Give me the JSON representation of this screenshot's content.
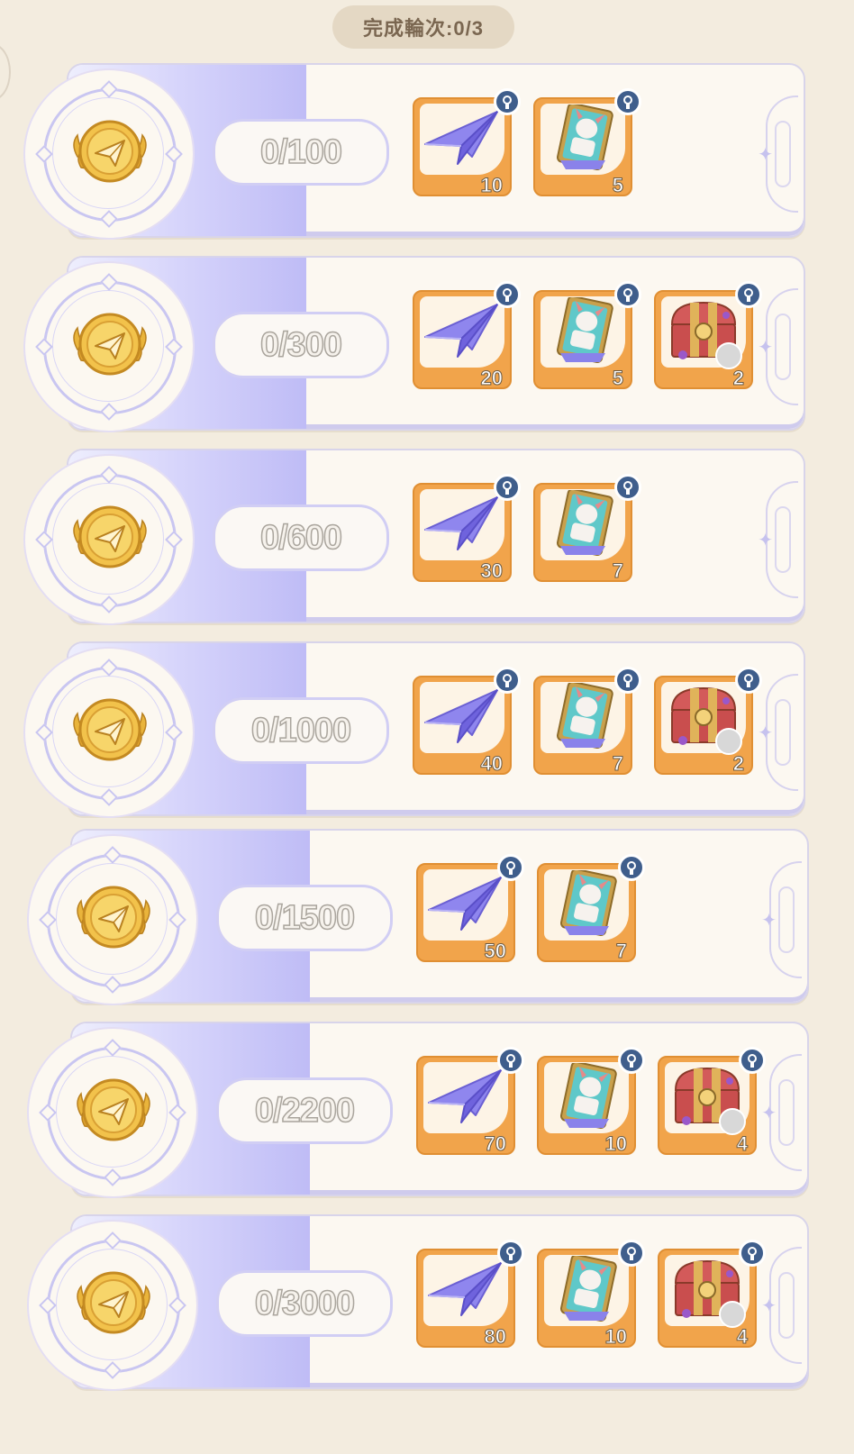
{
  "header": {
    "rounds_label": "完成輪次:0/3"
  },
  "tiers": [
    {
      "progress": "0/100",
      "rewards": [
        {
          "icon": "paper-plane",
          "qty": "10"
        },
        {
          "icon": "character-card",
          "qty": "5"
        }
      ]
    },
    {
      "progress": "0/300",
      "rewards": [
        {
          "icon": "paper-plane",
          "qty": "20"
        },
        {
          "icon": "character-card",
          "qty": "5"
        },
        {
          "icon": "treasure-chest",
          "qty": "2"
        }
      ]
    },
    {
      "progress": "0/600",
      "rewards": [
        {
          "icon": "paper-plane",
          "qty": "30"
        },
        {
          "icon": "character-card",
          "qty": "7"
        }
      ]
    },
    {
      "progress": "0/1000",
      "rewards": [
        {
          "icon": "paper-plane",
          "qty": "40"
        },
        {
          "icon": "character-card",
          "qty": "7"
        },
        {
          "icon": "treasure-chest",
          "qty": "2"
        }
      ]
    },
    {
      "progress": "0/1500",
      "rewards": [
        {
          "icon": "paper-plane",
          "qty": "50"
        },
        {
          "icon": "character-card",
          "qty": "7"
        }
      ]
    },
    {
      "progress": "0/2200",
      "rewards": [
        {
          "icon": "paper-plane",
          "qty": "70"
        },
        {
          "icon": "character-card",
          "qty": "10"
        },
        {
          "icon": "treasure-chest",
          "qty": "4"
        }
      ]
    },
    {
      "progress": "0/3000",
      "rewards": [
        {
          "icon": "paper-plane",
          "qty": "80"
        },
        {
          "icon": "character-card",
          "qty": "10"
        },
        {
          "icon": "treasure-chest",
          "qty": "4"
        }
      ]
    }
  ],
  "colors": {
    "background": "#f3ecdf",
    "card": "#fcf8f1",
    "lavender": "#bfbcf6",
    "item_frame": "#f1a44b",
    "lock_badge": "#3f5e8c"
  }
}
